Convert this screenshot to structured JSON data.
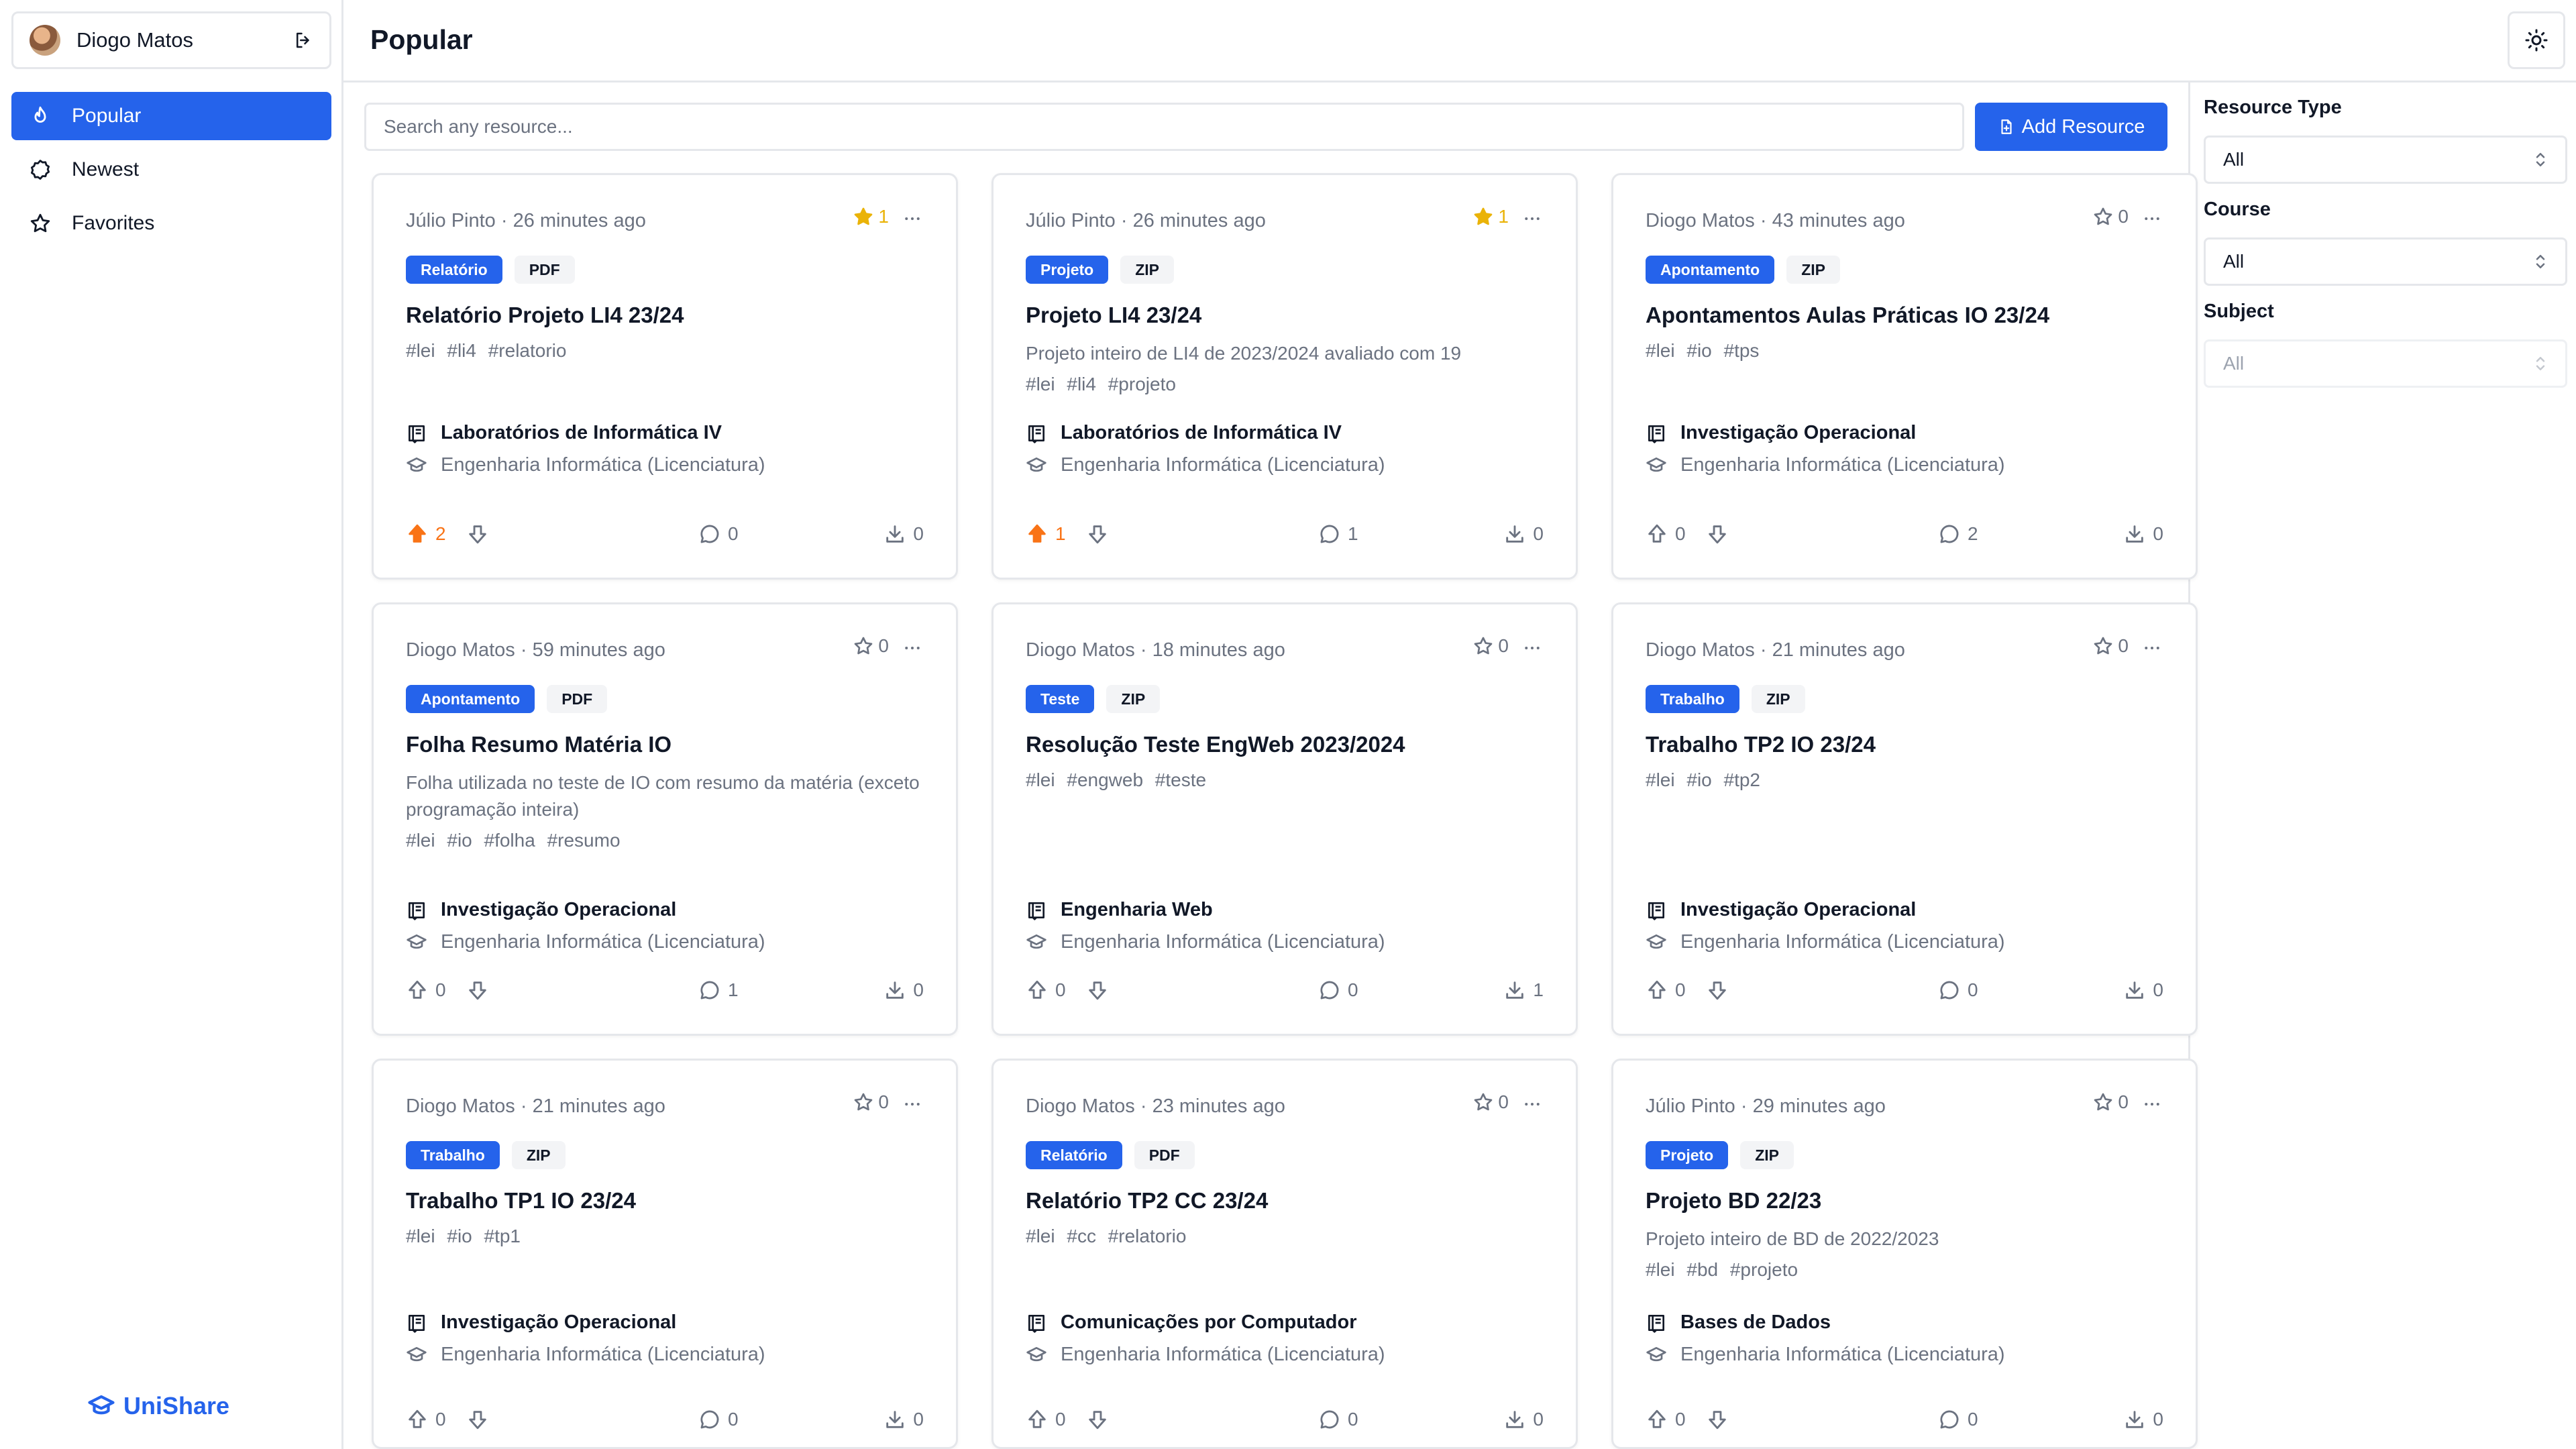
{
  "user": {
    "name": "Diogo Matos"
  },
  "nav": [
    {
      "label": "Popular",
      "icon": "flame-icon",
      "active": true
    },
    {
      "label": "Newest",
      "icon": "badge-icon",
      "active": false
    },
    {
      "label": "Favorites",
      "icon": "star-icon",
      "active": false
    }
  ],
  "brand": "UniShare",
  "header": {
    "title": "Popular"
  },
  "search": {
    "placeholder": "Search any resource..."
  },
  "add_button": {
    "label": "Add Resource"
  },
  "filters": {
    "resource_type": {
      "label": "Resource Type",
      "value": "All"
    },
    "course": {
      "label": "Course",
      "value": "All"
    },
    "subject": {
      "label": "Subject",
      "value": "All"
    }
  },
  "colors": {
    "accent": "#2563eb",
    "upvote_active": "#f97316",
    "star_active": "#eab308"
  },
  "cards": [
    {
      "meta": "Júlio Pinto · 26 minutes ago",
      "favorites": "1",
      "favorited": true,
      "type": "Relatório",
      "format": "PDF",
      "title": "Relatório Projeto LI4 23/24",
      "description": "",
      "hashtags": "#lei #li4 #relatorio",
      "subject": "Laboratórios de Informática IV",
      "course": "Engenharia Informática (Licenciatura)",
      "upvotes": "2",
      "upvoted": true,
      "comments": "0",
      "downloads": "0"
    },
    {
      "meta": "Júlio Pinto · 26 minutes ago",
      "favorites": "1",
      "favorited": true,
      "type": "Projeto",
      "format": "ZIP",
      "title": "Projeto LI4 23/24",
      "description": "Projeto inteiro de LI4 de 2023/2024 avaliado com 19",
      "hashtags": "#lei #li4 #projeto",
      "subject": "Laboratórios de Informática IV",
      "course": "Engenharia Informática (Licenciatura)",
      "upvotes": "1",
      "upvoted": true,
      "comments": "1",
      "downloads": "0"
    },
    {
      "meta": "Diogo Matos · 43 minutes ago",
      "favorites": "0",
      "favorited": false,
      "type": "Apontamento",
      "format": "ZIP",
      "title": "Apontamentos Aulas Práticas IO 23/24",
      "description": "",
      "hashtags": "#lei #io #tps",
      "subject": "Investigação Operacional",
      "course": "Engenharia Informática (Licenciatura)",
      "upvotes": "0",
      "upvoted": false,
      "comments": "2",
      "downloads": "0"
    },
    {
      "meta": "Diogo Matos · 59 minutes ago",
      "favorites": "0",
      "favorited": false,
      "type": "Apontamento",
      "format": "PDF",
      "title": "Folha Resumo Matéria IO",
      "description": "Folha utilizada no teste de IO com resumo da matéria (exceto programação inteira)",
      "hashtags": "#lei #io #folha #resumo",
      "subject": "Investigação Operacional",
      "course": "Engenharia Informática (Licenciatura)",
      "upvotes": "0",
      "upvoted": false,
      "comments": "1",
      "downloads": "0"
    },
    {
      "meta": "Diogo Matos · 18 minutes ago",
      "favorites": "0",
      "favorited": false,
      "type": "Teste",
      "format": "ZIP",
      "title": "Resolução Teste EngWeb 2023/2024",
      "description": "",
      "hashtags": "#lei #engweb #teste",
      "subject": "Engenharia Web",
      "course": "Engenharia Informática (Licenciatura)",
      "upvotes": "0",
      "upvoted": false,
      "comments": "0",
      "downloads": "1"
    },
    {
      "meta": "Diogo Matos · 21 minutes ago",
      "favorites": "0",
      "favorited": false,
      "type": "Trabalho",
      "format": "ZIP",
      "title": "Trabalho TP2 IO 23/24",
      "description": "",
      "hashtags": "#lei #io #tp2",
      "subject": "Investigação Operacional",
      "course": "Engenharia Informática (Licenciatura)",
      "upvotes": "0",
      "upvoted": false,
      "comments": "0",
      "downloads": "0"
    },
    {
      "meta": "Diogo Matos · 21 minutes ago",
      "favorites": "0",
      "favorited": false,
      "type": "Trabalho",
      "format": "ZIP",
      "title": "Trabalho TP1 IO 23/24",
      "description": "",
      "hashtags": "#lei #io #tp1",
      "subject": "Investigação Operacional",
      "course": "Engenharia Informática (Licenciatura)",
      "upvotes": "0",
      "upvoted": false,
      "comments": "0",
      "downloads": "0"
    },
    {
      "meta": "Diogo Matos · 23 minutes ago",
      "favorites": "0",
      "favorited": false,
      "type": "Relatório",
      "format": "PDF",
      "title": "Relatório TP2 CC 23/24",
      "description": "",
      "hashtags": "#lei #cc #relatorio",
      "subject": "Comunicações por Computador",
      "course": "Engenharia Informática (Licenciatura)",
      "upvotes": "0",
      "upvoted": false,
      "comments": "0",
      "downloads": "0"
    },
    {
      "meta": "Júlio Pinto · 29 minutes ago",
      "favorites": "0",
      "favorited": false,
      "type": "Projeto",
      "format": "ZIP",
      "title": "Projeto BD 22/23",
      "description": "Projeto inteiro de BD de 2022/2023",
      "hashtags": "#lei #bd #projeto",
      "subject": "Bases de Dados",
      "course": "Engenharia Informática (Licenciatura)",
      "upvotes": "0",
      "upvoted": false,
      "comments": "0",
      "downloads": "0"
    }
  ]
}
